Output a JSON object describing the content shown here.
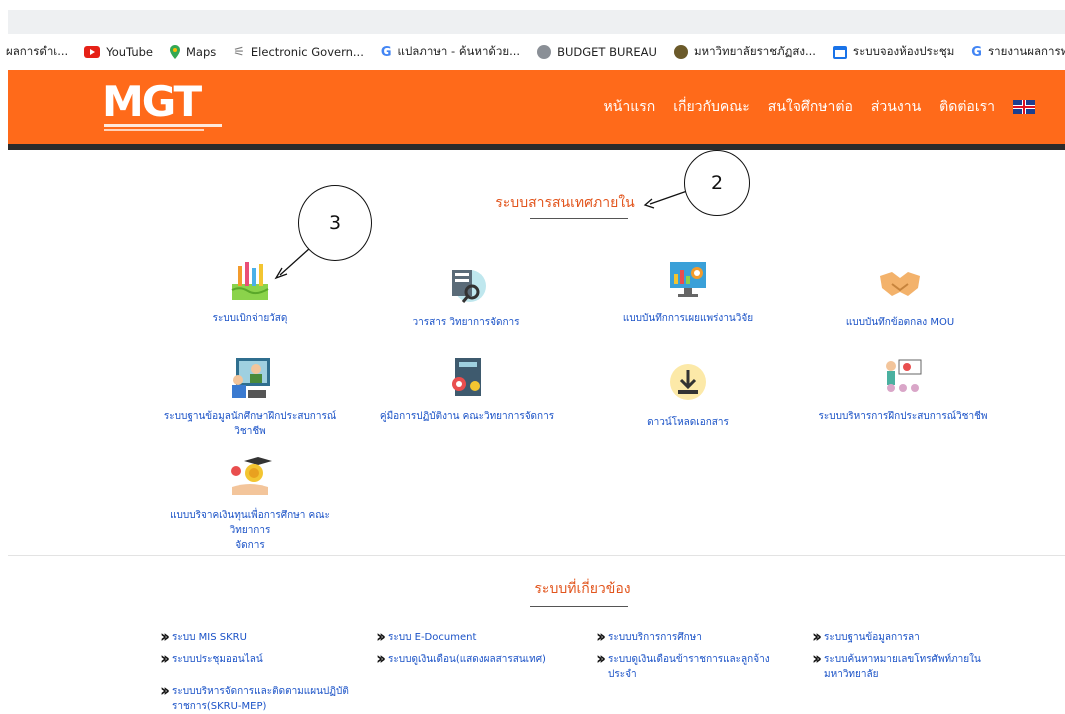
{
  "bookmarks": [
    {
      "label": "ผลการดำเ...",
      "icon": "folder-icon"
    },
    {
      "label": "YouTube",
      "icon": "youtube-icon"
    },
    {
      "label": "Maps",
      "icon": "maps-icon"
    },
    {
      "label": "Electronic Govern...",
      "icon": "gov-icon"
    },
    {
      "label": "แปลภาษา - ค้นหาด้วย...",
      "icon": "google-icon"
    },
    {
      "label": "BUDGET BUREAU",
      "icon": "budget-icon"
    },
    {
      "label": "มหาวิทยาลัยราชภัฏสง...",
      "icon": "university-icon"
    },
    {
      "label": "ระบบจองห้องประชุม",
      "icon": "calendar-icon"
    },
    {
      "label": "รายงานผลการทำงานที่...",
      "icon": "google-icon"
    }
  ],
  "header": {
    "logo_text": "MGT",
    "nav": [
      "หน้าแรก",
      "เกี่ยวกับคณะ",
      "สนใจศึกษาต่อ",
      "ส่วนงาน",
      "ติดต่อเรา"
    ],
    "accent": "#ff6a1a"
  },
  "internal": {
    "title": "ระบบสารสนเทศภายใน",
    "items": [
      {
        "label": "ระบบเบิกจ่ายวัสดุ",
        "icon": "stationery-icon"
      },
      {
        "label": "วารสาร วิทยาการจัดการ",
        "icon": "journal-search-icon"
      },
      {
        "label": "แบบบันทึกการเผยแพร่งานวิจัย",
        "icon": "research-chart-icon"
      },
      {
        "label": "แบบบันทึกข้อตกลง MOU",
        "icon": "handshake-icon"
      },
      {
        "label": "ระบบฐานข้อมูลนักศึกษาฝึกประสบการณ์วิชาชีพ",
        "icon": "video-teacher-icon"
      },
      {
        "label": "คู่มือการปฏิบัติงาน คณะวิทยาการจัดการ",
        "icon": "manual-book-icon"
      },
      {
        "label": "ดาวน์โหลดเอกสาร",
        "icon": "download-icon"
      },
      {
        "label": "ระบบบริหารการฝึกประสบการณ์วิชาชีพ",
        "icon": "training-presentation-icon"
      },
      {
        "label": "แบบบริจาคเงินทุนเพื่อการศึกษา คณะวิทยาการ",
        "label2": "จัดการ",
        "icon": "scholarship-icon"
      }
    ]
  },
  "callouts": {
    "two": "2",
    "three": "3"
  },
  "related": {
    "title": "ระบบที่เกี่ยวข้อง",
    "links": [
      {
        "label": "ระบบ MIS SKRU"
      },
      {
        "label": "ระบบ E-Document"
      },
      {
        "label": "ระบบบริการการศึกษา"
      },
      {
        "label": "ระบบฐานข้อมูลการลา"
      },
      {
        "label": "ระบบประชุมออนไลน์"
      },
      {
        "label": "ระบบดูเงินเดือน(แสดงผลสารสนเทศ)"
      },
      {
        "label": "ระบบดูเงินเดือนข้าราชการและลูกจ้าง",
        "label2": "ประจำ"
      },
      {
        "label": "ระบบค้นหาหมายเลขโทรศัพท์ภายใน",
        "label2": "มหาวิทยาลัย"
      },
      {
        "label": "ระบบบริหารจัดการและติดตามแผนปฏิบัติ",
        "label2": "ราชการ(SKRU-MEP)"
      }
    ]
  }
}
